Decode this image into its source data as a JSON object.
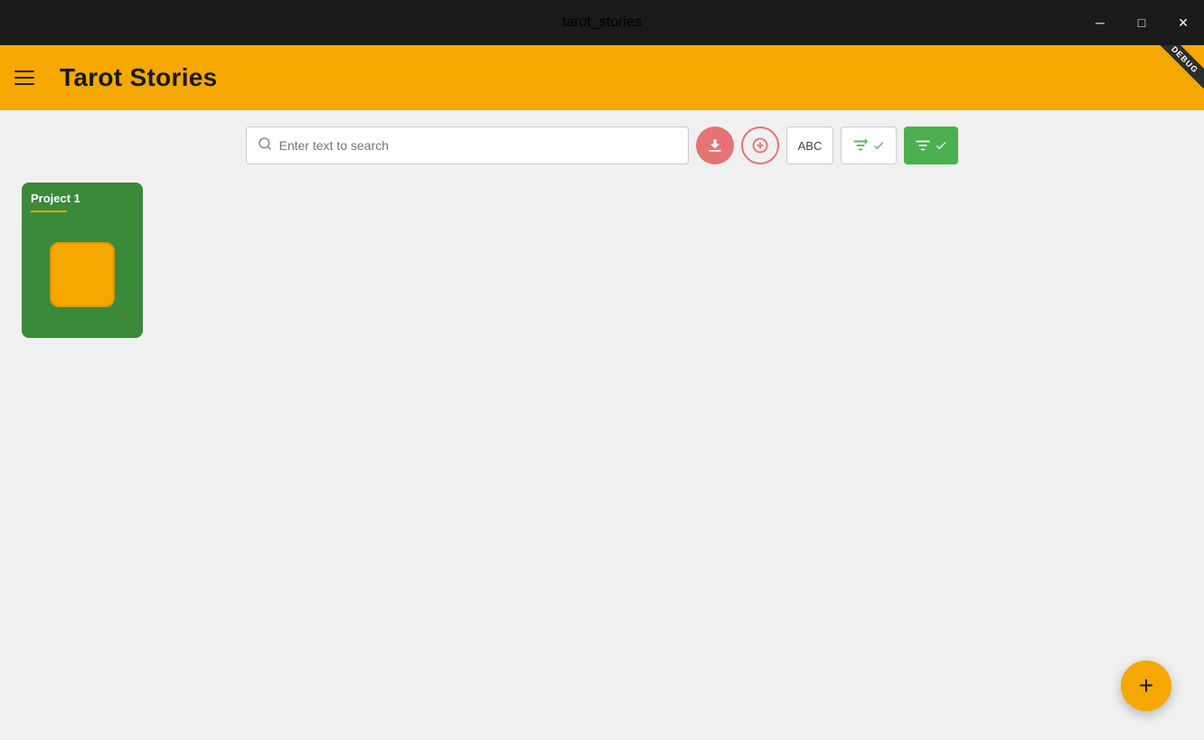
{
  "window": {
    "title": "tarot_stories"
  },
  "titlebar": {
    "title": "tarot_stories",
    "minimize_label": "─",
    "maximize_label": "□",
    "close_label": "✕"
  },
  "header": {
    "app_title": "Tarot Stories",
    "menu_icon": "hamburger-menu",
    "debug_label": "DEBUG"
  },
  "toolbar": {
    "search_placeholder": "Enter text to search",
    "download_icon": "download",
    "add_circle_icon": "add-circle",
    "text_icon": "ABC",
    "filter_icon": "filter-list",
    "check_all_icon": "check-all"
  },
  "projects": [
    {
      "name": "Project 1",
      "icon": "bar-chart"
    }
  ],
  "fab": {
    "label": "+"
  }
}
